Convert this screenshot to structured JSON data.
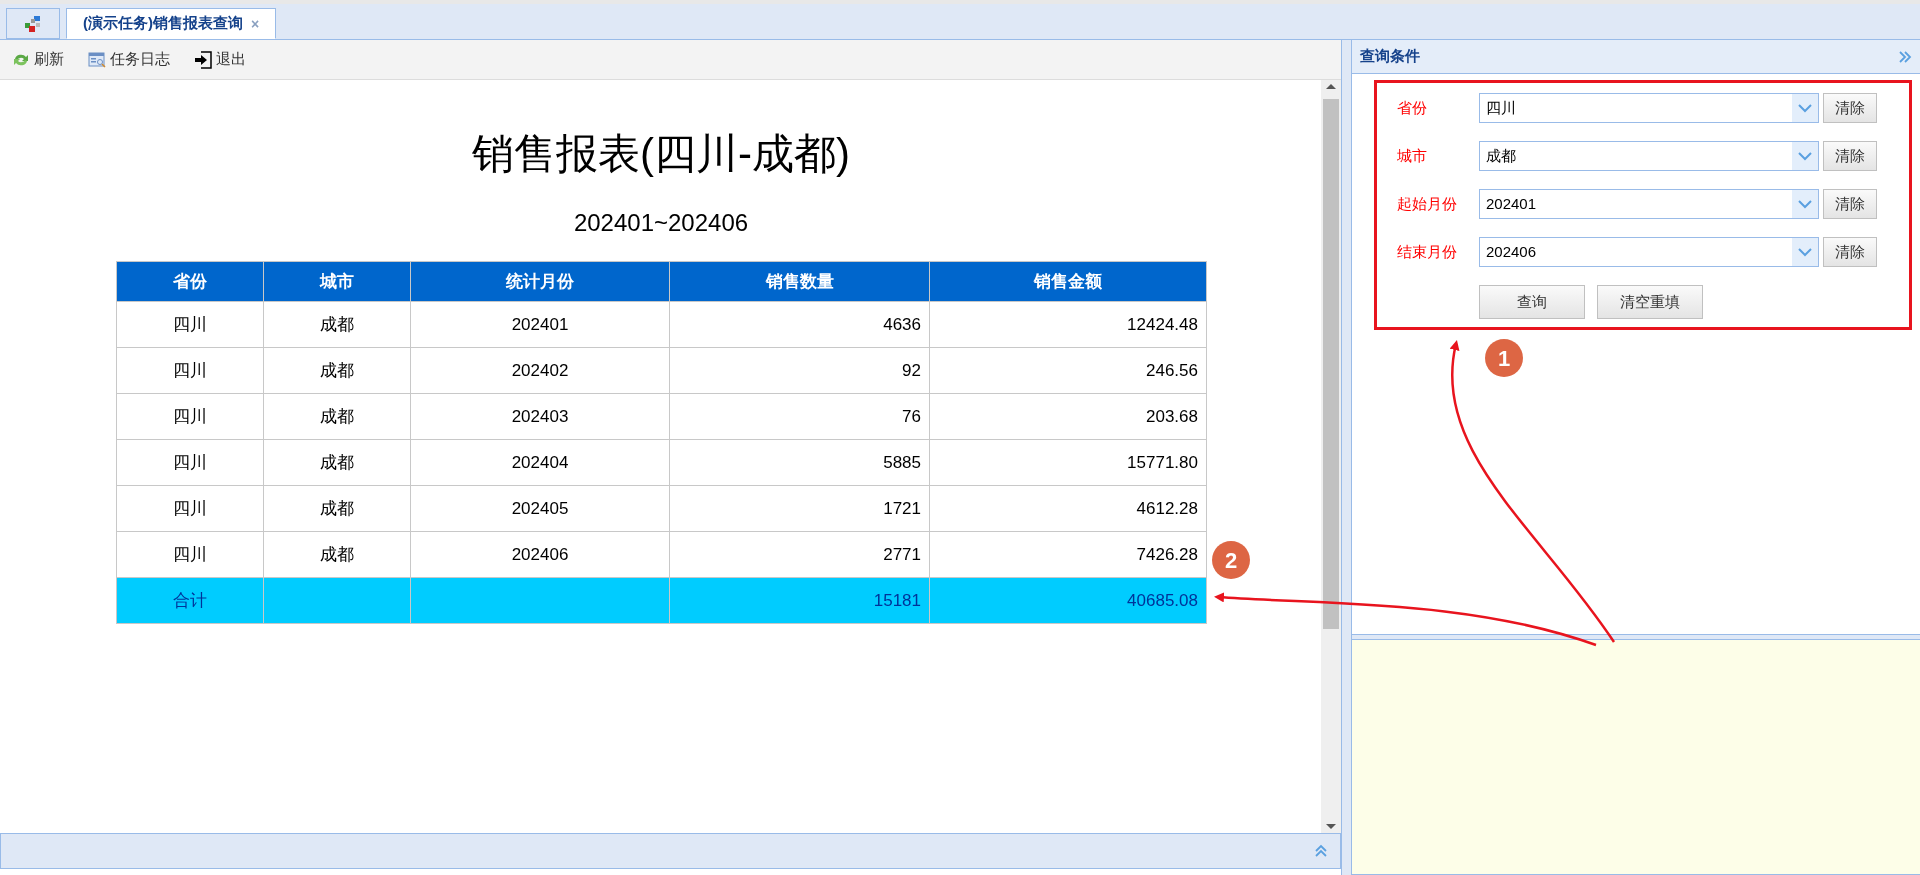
{
  "tabs": [
    {
      "kind": "home",
      "selected": false
    },
    {
      "kind": "page",
      "label": "(演示任务)销售报表查询",
      "close": "×",
      "selected": true
    }
  ],
  "toolbar": [
    {
      "kind": "refresh",
      "label": "刷新"
    },
    {
      "kind": "log",
      "label": "任务日志"
    },
    {
      "kind": "exit",
      "label": "退出"
    }
  ],
  "report": {
    "title": "销售报表(四川-成都)",
    "subtitle": "202401~202406",
    "table": {
      "columns": [
        "省份",
        "城市",
        "统计月份",
        "销售数量",
        "销售金额"
      ],
      "rows": [
        [
          "四川",
          "成都",
          "202401",
          "4636",
          "12424.48"
        ],
        [
          "四川",
          "成都",
          "202402",
          "92",
          "246.56"
        ],
        [
          "四川",
          "成都",
          "202403",
          "76",
          "203.68"
        ],
        [
          "四川",
          "成都",
          "202404",
          "5885",
          "15771.80"
        ],
        [
          "四川",
          "成都",
          "202405",
          "1721",
          "4612.28"
        ],
        [
          "四川",
          "成都",
          "202406",
          "2771",
          "7426.28"
        ]
      ],
      "total_row": {
        "label": "合计",
        "quantity": "15181",
        "amount": "40685.08"
      }
    }
  },
  "query_panel": {
    "title": "查询条件",
    "fields": [
      {
        "label": "省份",
        "value": "四川",
        "clear": "清除"
      },
      {
        "label": "城市",
        "value": "成都",
        "clear": "清除"
      },
      {
        "label": "起始月份",
        "value": "202401",
        "clear": "清除"
      },
      {
        "label": "结束月份",
        "value": "202406",
        "clear": "清除"
      }
    ],
    "buttons": [
      "查询",
      "清空重填"
    ]
  },
  "annotations": [
    {
      "number": "1"
    },
    {
      "number": "2"
    }
  ]
}
